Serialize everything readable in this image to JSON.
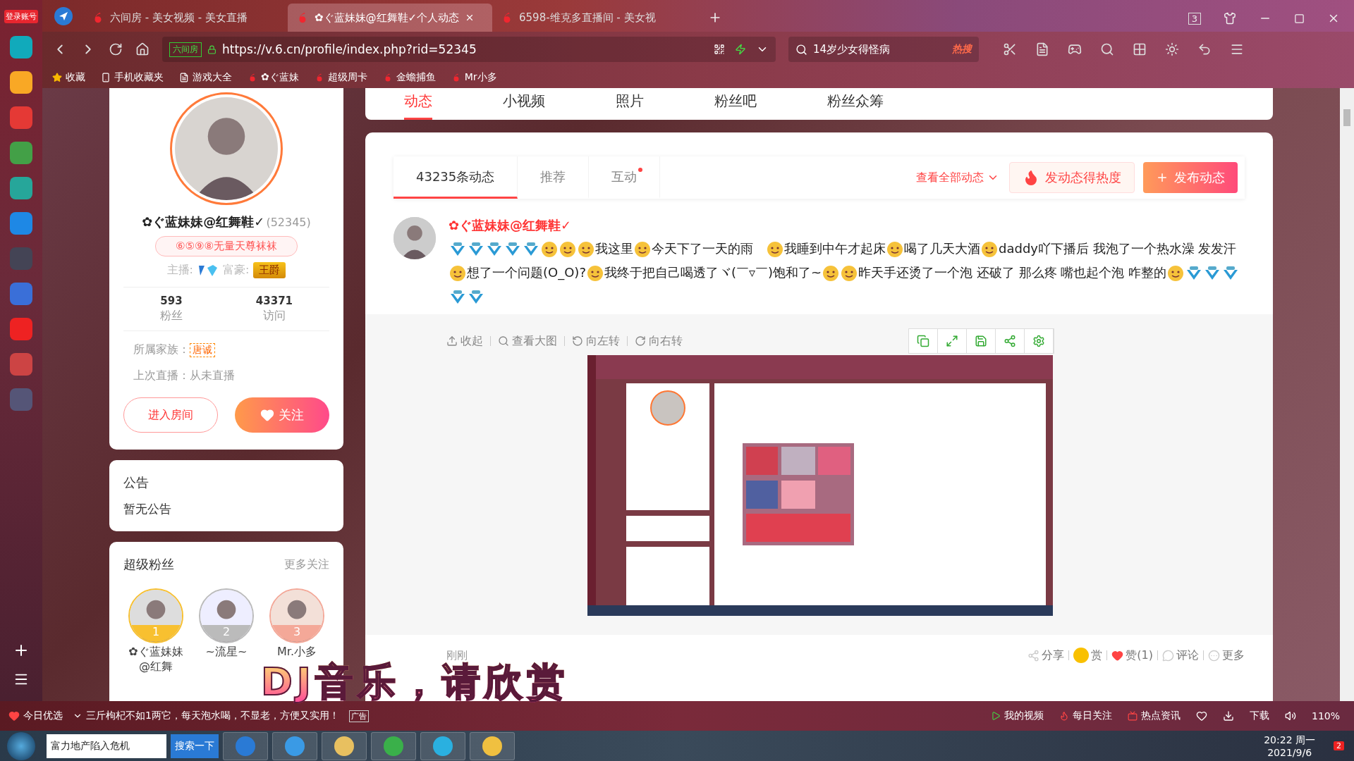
{
  "browser": {
    "login_badge": "登录账号",
    "tabs": [
      {
        "title": "六间房 - 美女视频 - 美女直播",
        "selected": false
      },
      {
        "title": "✿ぐ蓝妹妹@红舞鞋✓个人动态",
        "selected": true
      },
      {
        "title": "6598-维克多直播间 - 美女视",
        "selected": false
      }
    ],
    "tab_count": "3",
    "address": {
      "site_label": "六间房",
      "url": "https://v.6.cn/profile/index.php?rid=52345"
    },
    "search": {
      "value": "14岁少女得怪病",
      "hot_label": "热搜"
    },
    "bookmarks": [
      "收藏",
      "手机收藏夹",
      "游戏大全",
      "✿ぐ蓝妹",
      "超级周卡",
      "金蟾捕鱼",
      "Mr小多"
    ]
  },
  "profile_nav": [
    {
      "label": "动态",
      "selected": true
    },
    {
      "label": "小视频",
      "selected": false
    },
    {
      "label": "照片",
      "selected": false
    },
    {
      "label": "粉丝吧",
      "selected": false
    },
    {
      "label": "粉丝众筹",
      "selected": false
    }
  ],
  "profile": {
    "name": "✿ぐ蓝妹妹@红舞鞋✓",
    "id": "(52345)",
    "title_badge": "⑥⑤⑨⑧无量天尊袜袜",
    "host_label": "主播:",
    "wealth_label": "富豪:",
    "wealth_badge": "王爵",
    "stats": [
      {
        "value": "593",
        "label": "粉丝"
      },
      {
        "value": "43371",
        "label": "访问"
      }
    ],
    "family_label": "所属家族：",
    "family_badge": "唐诚",
    "last_live": "上次直播：从未直播",
    "buttons": [
      "进入房间",
      "关注"
    ]
  },
  "notice": {
    "title": "公告",
    "text": "暂无公告"
  },
  "super_fans": {
    "title": "超级粉丝",
    "more": "更多关注",
    "fans": [
      {
        "rank": "1",
        "name": "✿ぐ蓝妹妹@红舞"
      },
      {
        "rank": "2",
        "name": "~流星~"
      },
      {
        "rank": "3",
        "name": "Mr.小多"
      }
    ]
  },
  "feed": {
    "tabs": [
      {
        "label": "43235条动态",
        "selected": true,
        "dot": false
      },
      {
        "label": "推荐",
        "selected": false,
        "dot": false
      },
      {
        "label": "互动",
        "selected": false,
        "dot": true
      }
    ],
    "view_all": "查看全部动态",
    "heat_button": "发动态得热度",
    "publish_button": "发布动态",
    "post": {
      "author": "✿ぐ蓝妹妹@红舞鞋✓",
      "content": [
        {
          "kind": "level"
        },
        {
          "kind": "level"
        },
        {
          "kind": "level"
        },
        {
          "kind": "level"
        },
        {
          "kind": "level"
        },
        {
          "kind": "emoji"
        },
        {
          "kind": "emoji"
        },
        {
          "kind": "emoji"
        },
        {
          "kind": "text",
          "text": "我这里"
        },
        {
          "kind": "emoji"
        },
        {
          "kind": "text",
          "text": "今天下了一天的雨　"
        },
        {
          "kind": "emoji"
        },
        {
          "kind": "text",
          "text": "我睡到中午才起床"
        },
        {
          "kind": "emoji"
        },
        {
          "kind": "text",
          "text": "喝了几天大酒"
        },
        {
          "kind": "emoji"
        },
        {
          "kind": "text",
          "text": "daddy吖下播后 我泡了一个热水澡 发发汗 "
        },
        {
          "kind": "emoji"
        },
        {
          "kind": "text",
          "text": "想了一个问题(O_O)?"
        },
        {
          "kind": "emoji"
        },
        {
          "kind": "text",
          "text": "我终于把自己喝透了ヾ(￣▿￣)饱和了~"
        },
        {
          "kind": "emoji"
        },
        {
          "kind": "emoji"
        },
        {
          "kind": "text",
          "text": "昨天手还烫了一个泡 还破了 那么疼 嘴也起个泡 咋整的"
        },
        {
          "kind": "emoji"
        },
        {
          "kind": "level"
        },
        {
          "kind": "level"
        },
        {
          "kind": "level"
        },
        {
          "kind": "level"
        },
        {
          "kind": "level"
        }
      ],
      "image_tools": [
        "收起",
        "查看大图",
        "向左转",
        "向右转"
      ],
      "time": "刚刚",
      "actions": [
        "分享",
        "赏",
        "赞(1)",
        "评论",
        "更多"
      ]
    }
  },
  "status_bar": {
    "picks": "今日优选",
    "news": "三斤枸杞不如1两它，每天泡水喝，不显老，方便又实用！",
    "ad": "广告",
    "links": [
      "我的视频",
      "每日关注",
      "热点资讯"
    ],
    "download": "下载",
    "zoom": "110%"
  },
  "taskbar": {
    "search_value": "富力地产陷入危机",
    "search_button": "搜索一下",
    "time": "20:22 周一",
    "date": "2021/9/6",
    "notifications": "2"
  },
  "lyrics": "DJ音乐，请欣赏"
}
